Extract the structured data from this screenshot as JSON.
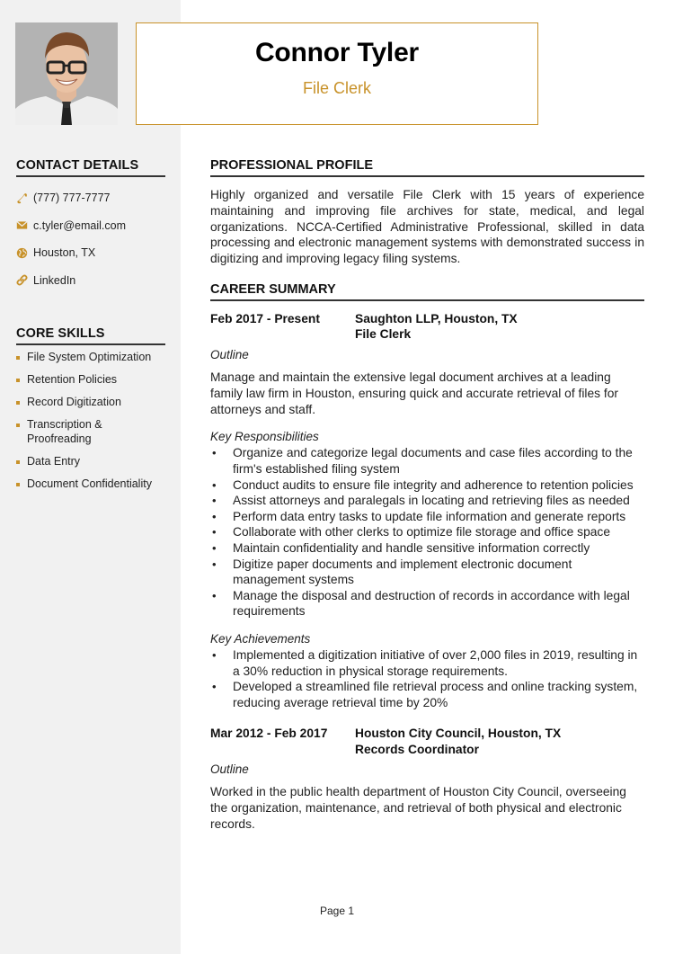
{
  "header": {
    "name": "Connor Tyler",
    "title": "File Clerk",
    "accent_color": "#c8922a"
  },
  "sidebar": {
    "contact": {
      "heading": "CONTACT DETAILS",
      "items": [
        {
          "icon": "phone-icon",
          "text": "(777) 777-7777"
        },
        {
          "icon": "envelope-icon",
          "text": "c.tyler@email.com"
        },
        {
          "icon": "globe-icon",
          "text": "Houston, TX"
        },
        {
          "icon": "link-icon",
          "text": "LinkedIn"
        }
      ]
    },
    "skills": {
      "heading": "CORE SKILLS",
      "items": [
        "File System Optimization",
        "Retention Policies",
        "Record Digitization",
        "Transcription & Proofreading",
        "Data Entry",
        "Document Confidentiality"
      ]
    }
  },
  "main": {
    "profile": {
      "heading": "PROFESSIONAL PROFILE",
      "text": "Highly organized and versatile File Clerk with 15 years of experience maintaining and improving file archives for state, medical, and legal organizations. NCCA-Certified Administrative Professional, skilled in data processing and electronic management systems with demonstrated success in digitizing and improving legacy filing systems."
    },
    "career": {
      "heading": "CAREER SUMMARY",
      "jobs": [
        {
          "dates": "Feb 2017 - Present",
          "company": "Saughton LLP, Houston, TX",
          "role": "File Clerk",
          "outline_label": "Outline",
          "outline": "Manage and maintain the extensive legal document archives at a leading family law firm in Houston, ensuring quick and accurate retrieval of files for attorneys and staff.",
          "responsibilities_label": "Key Responsibilities",
          "responsibilities": [
            "Organize and categorize legal documents and case files according to the firm's established filing system",
            "Conduct audits to ensure file integrity and adherence to retention policies",
            "Assist attorneys and paralegals in locating and retrieving files as needed",
            "Perform data entry tasks to update file information and generate reports",
            "Collaborate with other clerks to optimize file storage and office space",
            "Maintain confidentiality and handle sensitive information correctly",
            "Digitize paper documents and implement electronic document management systems",
            "Manage the disposal and destruction of records in accordance with legal requirements"
          ],
          "achievements_label": "Key Achievements",
          "achievements": [
            "Implemented a digitization initiative of over 2,000 files in 2019, resulting in a 30% reduction in physical storage requirements.",
            "Developed a streamlined file retrieval process and online tracking system, reducing average retrieval time by 20%"
          ]
        },
        {
          "dates": "Mar 2012 - Feb 2017",
          "company": "Houston City Council, Houston, TX",
          "role": "Records Coordinator",
          "outline_label": "Outline",
          "outline": "Worked in the public health department of Houston City Council, overseeing the organization, maintenance, and retrieval of both physical and electronic records."
        }
      ]
    }
  },
  "footer": {
    "page": "Page 1"
  }
}
